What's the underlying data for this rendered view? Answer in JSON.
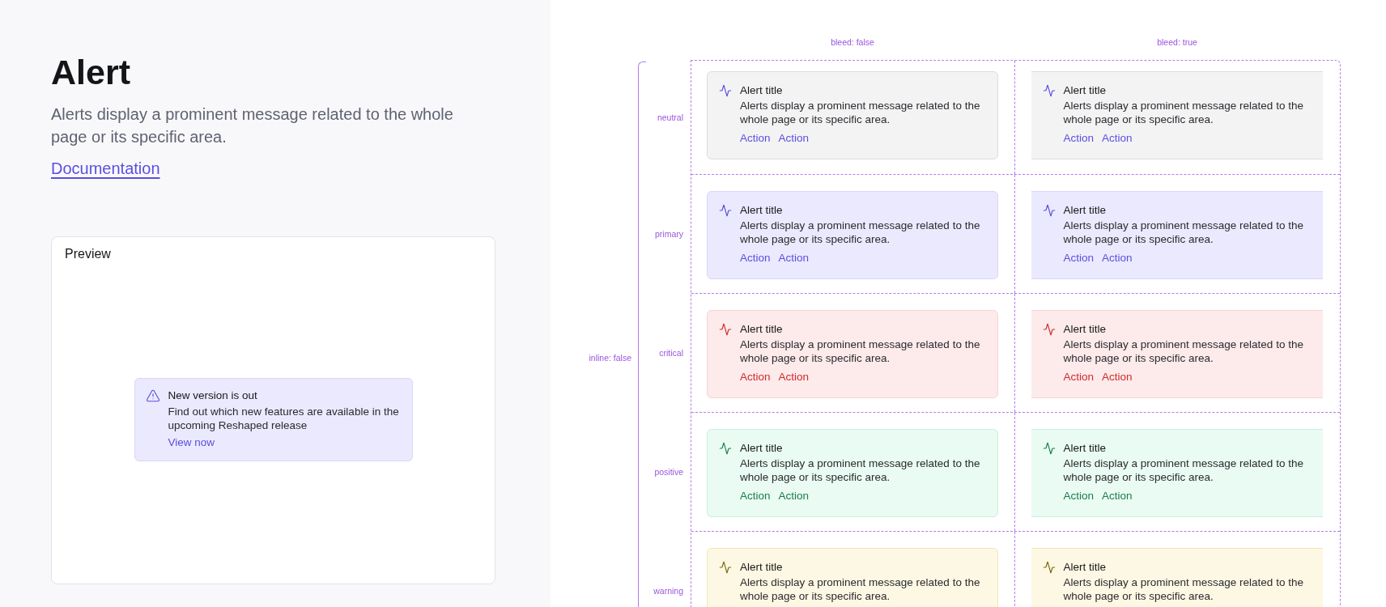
{
  "page": {
    "title": "Alert",
    "description": "Alerts display a prominent message related to the whole page or its specific area.",
    "link": "Documentation"
  },
  "preview": {
    "label": "Preview",
    "alert": {
      "title": "New version is out",
      "text": "Find out which new features are available in the upcoming Reshaped release",
      "action": "View now"
    }
  },
  "matrix": {
    "group_label": "inline: false",
    "columns": [
      {
        "label": "bleed: false",
        "bleed": false
      },
      {
        "label": "bleed: true",
        "bleed": true
      }
    ],
    "rows": [
      {
        "label": "neutral",
        "kind": "neutral",
        "cells": [
          {
            "title": "Alert title",
            "text": "Alerts display a prominent message related to the whole page or its specific area.",
            "actions": [
              "Action",
              "Action"
            ]
          },
          {
            "title": "Alert title",
            "text": "Alerts display a prominent message related to the whole page or its specific area.",
            "actions": [
              "Action",
              "Action"
            ]
          }
        ]
      },
      {
        "label": "primary",
        "kind": "primary",
        "cells": [
          {
            "title": "Alert title",
            "text": "Alerts display a prominent message related to the whole page or its specific area.",
            "actions": [
              "Action",
              "Action"
            ]
          },
          {
            "title": "Alert title",
            "text": "Alerts display a prominent message related to the whole page or its specific area.",
            "actions": [
              "Action",
              "Action"
            ]
          }
        ]
      },
      {
        "label": "critical",
        "kind": "critical",
        "cells": [
          {
            "title": "Alert title",
            "text": "Alerts display a prominent message related to the whole page or its specific area.",
            "actions": [
              "Action",
              "Action"
            ]
          },
          {
            "title": "Alert title",
            "text": "Alerts display a prominent message related to the whole page or its specific area.",
            "actions": [
              "Action",
              "Action"
            ]
          }
        ]
      },
      {
        "label": "positive",
        "kind": "positive",
        "cells": [
          {
            "title": "Alert title",
            "text": "Alerts display a prominent message related to the whole page or its specific area.",
            "actions": [
              "Action",
              "Action"
            ]
          },
          {
            "title": "Alert title",
            "text": "Alerts display a prominent message related to the whole page or its specific area.",
            "actions": [
              "Action",
              "Action"
            ]
          }
        ]
      },
      {
        "label": "warning",
        "kind": "warning",
        "cells": [
          {
            "title": "Alert title",
            "text": "Alerts display a prominent message related to the whole page or its specific area."
          },
          {
            "title": "Alert title",
            "text": "Alerts display a prominent message related to the whole page or its specific area."
          }
        ]
      }
    ]
  }
}
